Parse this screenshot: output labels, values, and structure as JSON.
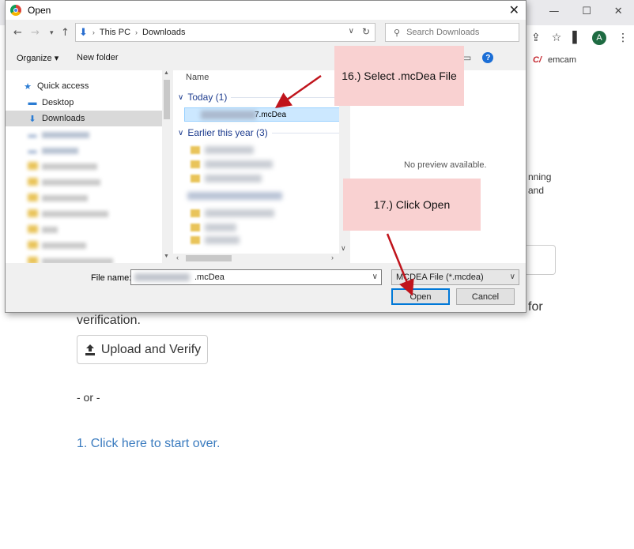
{
  "dialog": {
    "title": "Open",
    "close": "✕",
    "breadcrumb": [
      "This PC",
      "Downloads"
    ],
    "search_placeholder": "Search Downloads",
    "organize_label": "Organize ▾",
    "new_folder_label": "New folder",
    "nav": {
      "quick_access": "Quick access",
      "items": [
        {
          "label": "Desktop"
        },
        {
          "label": "Downloads"
        }
      ]
    },
    "file_list": {
      "column_name": "Name",
      "groups": [
        {
          "label": "Today (1)"
        },
        {
          "label": "Earlier this year (3)"
        }
      ],
      "selected_file_suffix": "7.mcDea"
    },
    "preview_text": "No preview available.",
    "filename_label": "File name:",
    "filename_value": ".mcDea",
    "filetype_value": "MCDEA File (*.mcdea)",
    "open_label": "Open",
    "cancel_label": "Cancel"
  },
  "browser": {
    "bookmark_label": "emcam",
    "avatar_letter": "A",
    "frag_line1": "nning",
    "frag_line2": "and",
    "frag_for": "for"
  },
  "page": {
    "verification_text": "verification.",
    "upload_label": "Upload and Verify",
    "or_text": "- or -",
    "start_over": "1. Click here to start over."
  },
  "callouts": {
    "step16": "16.) Select .mcDea File",
    "step17": "17.) Click Open"
  },
  "colors": {
    "callout_bg": "#f9d1d1",
    "arrow": "#c0141c",
    "link": "#3a7bbf",
    "selection": "#cce8ff",
    "accent": "#0078d7"
  }
}
